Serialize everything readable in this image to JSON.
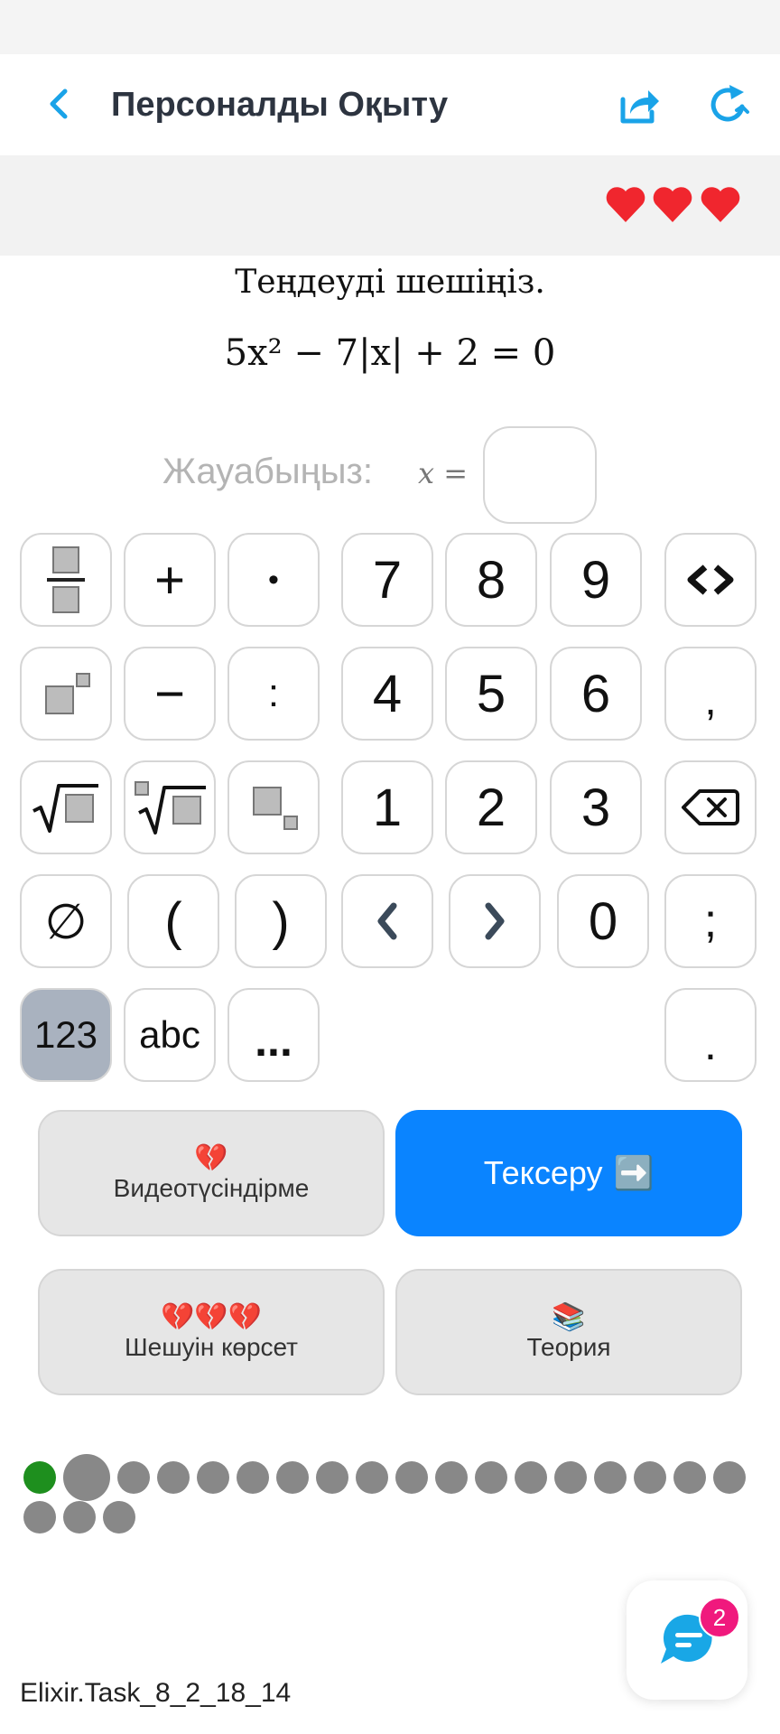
{
  "header": {
    "title": "Персоналды Оқыту",
    "back_icon": "chevron-left-icon",
    "share_icon": "share-icon",
    "refresh_icon": "refresh-icon",
    "accent": "#1aa3e8"
  },
  "lives": {
    "count": 3,
    "color": "#f0262e"
  },
  "question": {
    "prompt": "Теңдеуді шешіңіз.",
    "formula": "5x² − 7|x| + 2 = 0"
  },
  "answer": {
    "label": "Жауабыңыз:",
    "variable": "x =",
    "value": ""
  },
  "keypad": {
    "row1": [
      "fraction",
      "+",
      "•",
      "7",
      "8",
      "9",
      "<>"
    ],
    "row2": [
      "power",
      "−",
      ":",
      "4",
      "5",
      "6",
      ","
    ],
    "row3": [
      "sqrt",
      "nth-root",
      "subscript",
      "1",
      "2",
      "3",
      "backspace"
    ],
    "row4": [
      "∅",
      "(",
      ")",
      "<",
      ">",
      "0",
      ";"
    ],
    "row5": [
      "123",
      "abc",
      "...",
      "."
    ]
  },
  "actions": {
    "video": {
      "emoji": "💔",
      "label": "Видеотүсіндірме"
    },
    "check": {
      "label": "Тексеру",
      "emoji": "➡️"
    },
    "solution": {
      "emoji": "💔💔💔",
      "label": "Шешуін көрсет"
    },
    "theory": {
      "emoji": "📚",
      "label": "Теория"
    }
  },
  "progress": {
    "total": 21,
    "done": 1,
    "current": 2,
    "done_color": "#1e8f1e",
    "pending_color": "#888888"
  },
  "chat": {
    "badge": "2"
  },
  "footer": {
    "task_id": "Elixir.Task_8_2_18_14"
  }
}
